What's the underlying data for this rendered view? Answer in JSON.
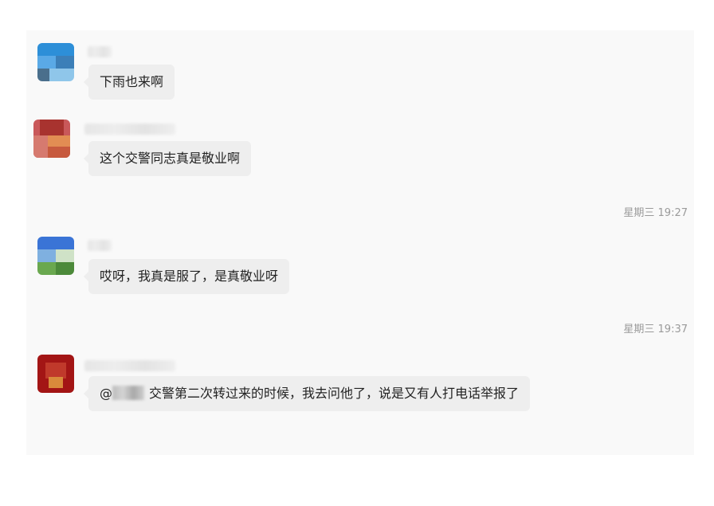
{
  "messages": [
    {
      "text": "下雨也来啊"
    },
    {
      "text": "这个交警同志真是敬业啊"
    },
    {
      "text": "哎呀，我真是服了，是真敬业呀"
    },
    {
      "mention": "@",
      "text": "交警第二次转过来的时候，我去问他了，说是又有人打电话举报了"
    }
  ],
  "timestamps": [
    "星期三 19:27",
    "星期三 19:37"
  ],
  "colors": {
    "panel_bg": "#f9f9f9",
    "bubble_bg": "#eeeeee",
    "timestamp_text": "#9a9a9a"
  }
}
